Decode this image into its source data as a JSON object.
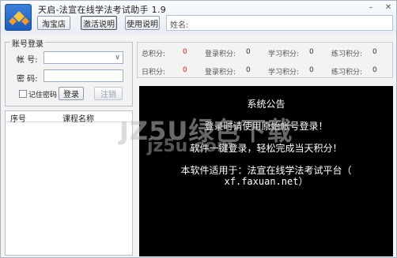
{
  "app": {
    "title": "天启-法宣在线学法考试助手 1.9",
    "logo": "diamond-logo"
  },
  "toolbar": {
    "taobao": "淘宝店",
    "activate": "激活说明",
    "usage": "使用说明",
    "name_label": "姓名:"
  },
  "login": {
    "group_title": "账号登录",
    "account_label": "帐  号:",
    "account_value": "",
    "password_label": "密  码:",
    "password_value": "",
    "remember_label": "记住密码",
    "login_button": "登录",
    "logout_button": "注销"
  },
  "course_list": {
    "columns": [
      "序号",
      "课程名称"
    ],
    "rows": []
  },
  "scores": {
    "row1": [
      {
        "label": "总积分:",
        "value": "0",
        "highlight": true
      },
      {
        "label": "登录积分:",
        "value": "0"
      },
      {
        "label": "学习积分:",
        "value": "0"
      },
      {
        "label": "练习积分:",
        "value": "0"
      }
    ],
    "row2": [
      {
        "label": "日积分:",
        "value": "0",
        "highlight": true
      },
      {
        "label": "登录积分:",
        "value": "0"
      },
      {
        "label": "学习积分:",
        "value": "0"
      },
      {
        "label": "练习积分:",
        "value": "0"
      }
    ]
  },
  "announcement": {
    "title": "系统公告",
    "lines": [
      "登录时请使用原始帐号登录！",
      "软件一键登录，轻松完成当天积分！",
      "本软件适用于：法宣在线学法考试平台（",
      "xf.faxuan.net）"
    ]
  },
  "watermark": {
    "main": "JZ5U绿色下载",
    "sub": "jz5u.com"
  },
  "colors": {
    "accent": "#1d5db9",
    "score_highlight": "#e02020",
    "announce_bg": "#000000"
  }
}
